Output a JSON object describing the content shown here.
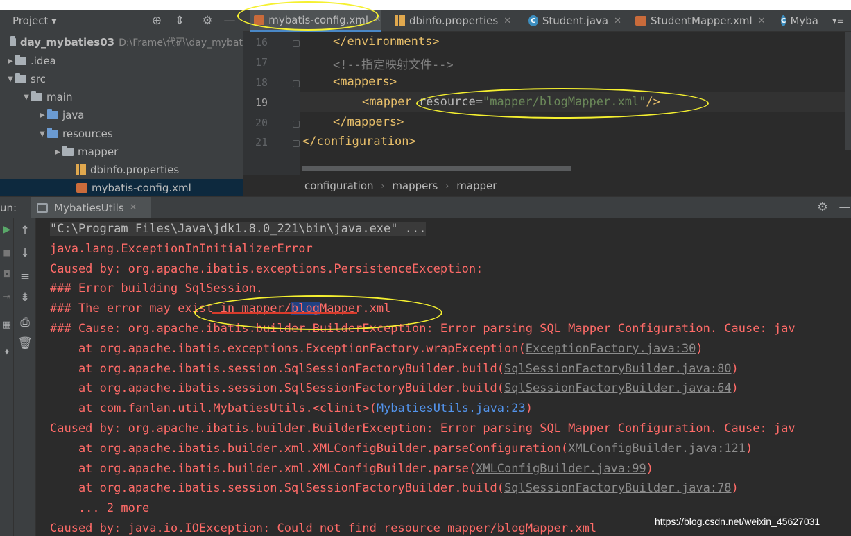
{
  "project_panel": {
    "title": "Project",
    "tree": [
      {
        "label": "day_mybaties03",
        "hint": "D:\\Frame\\代码\\day_mybat",
        "type": "module"
      },
      {
        "label": ".idea",
        "type": "folder"
      },
      {
        "label": "src",
        "type": "folder"
      },
      {
        "label": "main",
        "type": "folder"
      },
      {
        "label": "java",
        "type": "folder"
      },
      {
        "label": "resources",
        "type": "folder"
      },
      {
        "label": "mapper",
        "type": "folder"
      },
      {
        "label": "dbinfo.properties",
        "type": "properties"
      },
      {
        "label": "mybatis-config.xml",
        "type": "xml"
      }
    ]
  },
  "editor_tabs": [
    {
      "label": "mybatis-config.xml",
      "icon": "xml-file-icon",
      "active": true
    },
    {
      "label": "dbinfo.properties",
      "icon": "properties-file-icon",
      "active": false
    },
    {
      "label": "Student.java",
      "icon": "java-class-icon",
      "active": false
    },
    {
      "label": "StudentMapper.xml",
      "icon": "xml-file-icon",
      "active": false
    },
    {
      "label": "Myba",
      "icon": "java-class-icon",
      "active": false
    }
  ],
  "tab_overflow": "≡",
  "editor": {
    "lines": [
      {
        "num": "16",
        "text": "</environments>"
      },
      {
        "num": "17",
        "text": "<!--指定映射文件-->"
      },
      {
        "num": "18",
        "text": "<mappers>"
      },
      {
        "num": "19",
        "tag_open": "<mapper ",
        "attr": "resource=",
        "value": "\"mapper/blogMapper.xml\"",
        "tag_close": "/>"
      },
      {
        "num": "20",
        "text": "</mappers>"
      },
      {
        "num": "21",
        "text": "</configuration>"
      }
    ],
    "current_line": "19"
  },
  "breadcrumb": [
    "configuration",
    "mappers",
    "mapper"
  ],
  "run_panel": {
    "label": "un:",
    "tab": "MybatiesUtils"
  },
  "console": {
    "lines": [
      {
        "text": "\"C:\\Program Files\\Java\\jdk1.8.0_221\\bin\\java.exe\" ...",
        "kind": "cmd"
      },
      {
        "text": "java.lang.ExceptionInInitializerError"
      },
      {
        "text": "Caused by: org.apache.ibatis.exceptions.PersistenceException: "
      },
      {
        "text": "### Error building SqlSession."
      },
      {
        "pre": "### The error may exist in mapper/",
        "sel": "blog",
        "post": "Mapper.xml"
      },
      {
        "text": "### Cause: org.apache.ibatis.builder.BuilderException: Error parsing SQL Mapper Configuration. Cause: jav"
      },
      {
        "pre": "    at org.apache.ibatis.exceptions.ExceptionFactory.wrapException(",
        "link": "ExceptionFactory.java:30",
        "link_kind": "grey",
        "post": ")"
      },
      {
        "pre": "    at org.apache.ibatis.session.SqlSessionFactoryBuilder.build(",
        "link": "SqlSessionFactoryBuilder.java:80",
        "link_kind": "grey",
        "post": ")"
      },
      {
        "pre": "    at org.apache.ibatis.session.SqlSessionFactoryBuilder.build(",
        "link": "SqlSessionFactoryBuilder.java:64",
        "link_kind": "grey",
        "post": ")"
      },
      {
        "pre": "    at com.fanlan.util.MybatiesUtils.<clinit>(",
        "link": "MybatiesUtils.java:23",
        "link_kind": "blue",
        "post": ")"
      },
      {
        "text": "Caused by: org.apache.ibatis.builder.BuilderException: Error parsing SQL Mapper Configuration. Cause: jav"
      },
      {
        "pre": "    at org.apache.ibatis.builder.xml.XMLConfigBuilder.parseConfiguration(",
        "link": "XMLConfigBuilder.java:121",
        "link_kind": "grey",
        "post": ")"
      },
      {
        "pre": "    at org.apache.ibatis.builder.xml.XMLConfigBuilder.parse(",
        "link": "XMLConfigBuilder.java:99",
        "link_kind": "grey",
        "post": ")"
      },
      {
        "pre": "    at org.apache.ibatis.session.SqlSessionFactoryBuilder.build(",
        "link": "SqlSessionFactoryBuilder.java:78",
        "link_kind": "grey",
        "post": ")"
      },
      {
        "text": "    ... 2 more"
      },
      {
        "text": "Caused by: java.io.IOException: Could not find resource mapper/blogMapper.xml"
      }
    ]
  },
  "watermark": "https://blog.csdn.net/weixin_45627031",
  "colors": {
    "error_red": "#ff6b68",
    "link_blue": "#5394ec",
    "annotation_yellow": "#f5f030",
    "xml_tag": "#e8bf6a",
    "xml_value": "#6a8759"
  }
}
